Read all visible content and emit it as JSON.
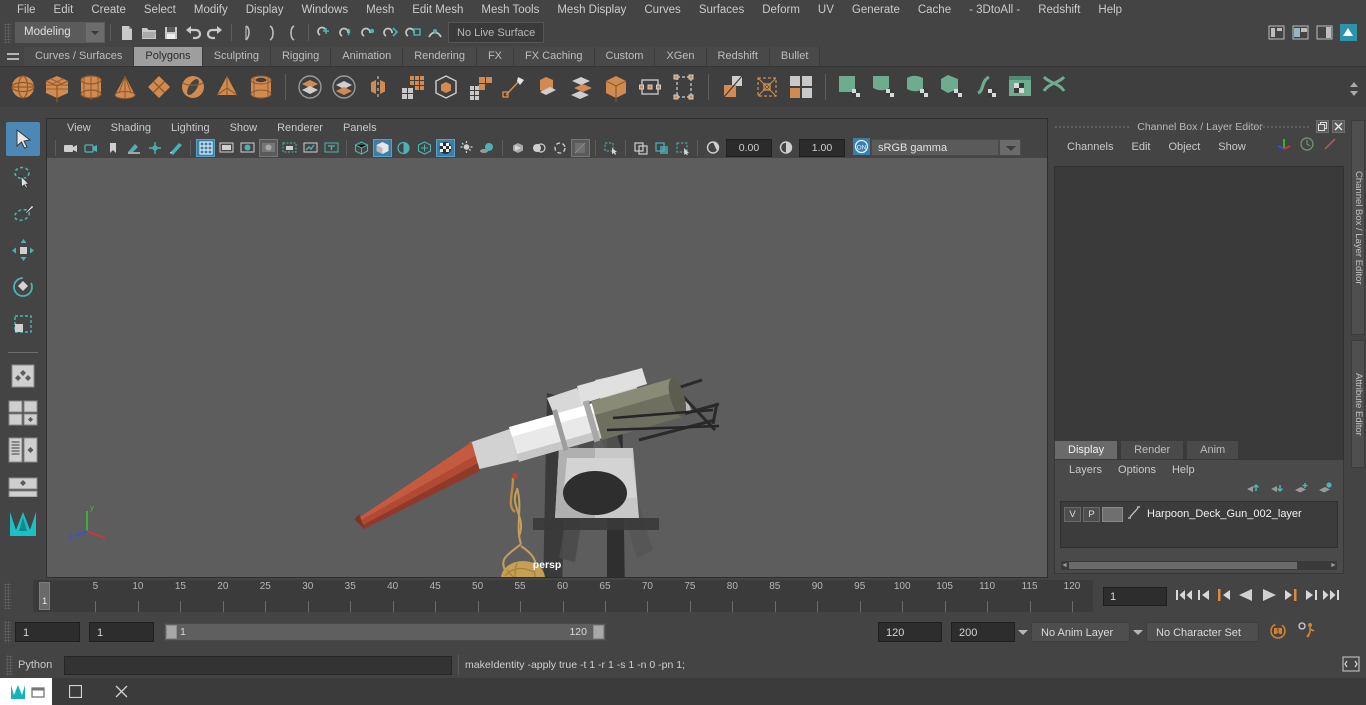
{
  "menubar": {
    "items": [
      "File",
      "Edit",
      "Create",
      "Select",
      "Modify",
      "Display",
      "Windows",
      "Mesh",
      "Edit Mesh",
      "Mesh Tools",
      "Mesh Display",
      "Curves",
      "Surfaces",
      "Deform",
      "UV",
      "Generate",
      "Cache",
      "- 3DtoAll -",
      "Redshift",
      "Help"
    ]
  },
  "statusline": {
    "mode": "Modeling",
    "live_surface": "No Live Surface",
    "icons": [
      "new-scene-icon",
      "open-scene-icon",
      "save-scene-icon",
      "undo-icon",
      "redo-icon",
      "select-hierarchy-icon",
      "select-object-icon",
      "select-component-icon",
      "snap-grid-icon",
      "snap-curve-icon",
      "snap-point-icon",
      "snap-projected-icon",
      "snap-view-plane-icon",
      "make-live-icon"
    ]
  },
  "shelf": {
    "tabs": [
      "Curves / Surfaces",
      "Polygons",
      "Sculpting",
      "Rigging",
      "Animation",
      "Rendering",
      "FX",
      "FX Caching",
      "Custom",
      "XGen",
      "Redshift",
      "Bullet"
    ],
    "active_tab": "Polygons",
    "buttons": [
      "poly-sphere-icon",
      "poly-cube-icon",
      "poly-cylinder-icon",
      "poly-cone-icon",
      "poly-plane-icon",
      "poly-torus-icon",
      "poly-pyramid-icon",
      "poly-pipe-icon",
      "combine-icon",
      "separate-icon",
      "mirror-icon",
      "smooth-icon",
      "boolean-icon",
      "subdiv-proxy-icon",
      "multi-cut-icon",
      "extrude-icon",
      "bevel-icon",
      "bridge-icon",
      "append-polygon-icon",
      "target-weld-icon",
      "quad-draw-icon",
      "crease-tool-icon",
      "poly-uv-icon",
      "uv-editor-icon",
      "auto-uv-icon",
      "planar-map-icon",
      "cylindrical-map-icon",
      "spherical-map-icon",
      "unfold-uv-icon",
      "uv-layout-icon",
      "uv-snapshot-icon"
    ]
  },
  "toolbox": {
    "items": [
      "select-tool-icon",
      "lasso-select-tool-icon",
      "paint-select-tool-icon",
      "move-tool-icon",
      "rotate-tool-icon",
      "scale-tool-icon",
      "last-tool-icon",
      "single-pane-layout-icon",
      "four-pane-layout-icon",
      "persp-outliner-layout-icon",
      "persp-graph-layout-icon",
      "maya-logo-icon"
    ],
    "active": "select-tool-icon"
  },
  "viewport": {
    "menus": [
      "View",
      "Shading",
      "Lighting",
      "Show",
      "Renderer",
      "Panels"
    ],
    "toolbar_icons": [
      "select-camera-icon",
      "camera-attributes-icon",
      "bookmark-icon",
      "image-plane-icon",
      "two-d-pan-zoom-icon",
      "grease-pencil-icon",
      "grid-toggle-icon",
      "film-gate-icon",
      "resolution-gate-icon",
      "gate-mask-icon",
      "film-origin-icon",
      "exposure-icon",
      "title-safe-icon",
      "wireframe-icon",
      "smooth-shade-icon",
      "shaded-wireframe-icon",
      "textured-icon",
      "checker-texture-icon",
      "use-lights-icon",
      "shadows-icon",
      "ambient-occlusion-icon",
      "motion-blur-icon",
      "multisample-icon",
      "depth-of-field-icon",
      "isolate-select-icon",
      "xray-icon",
      "xray-joints-icon",
      "xray-active-components-icon",
      "exposure-wheel-icon",
      "gamma-icon"
    ],
    "exposure": "0.00",
    "gamma": "1.00",
    "color_management": "sRGB gamma",
    "color_management_toggle": "ON",
    "camera_label": "persp",
    "axis_labels": {
      "x": "x",
      "y": "y",
      "z": "z"
    }
  },
  "channel_box": {
    "title": "Channel Box / Layer Editor",
    "menus": [
      "Channels",
      "Edit",
      "Object",
      "Show"
    ],
    "header_icons": [
      "axis-icon",
      "clock-icon",
      "pencil-icon"
    ],
    "window_buttons": [
      "restore-icon",
      "close-icon"
    ]
  },
  "layer_editor": {
    "tabs": [
      "Display",
      "Render",
      "Anim"
    ],
    "active_tab": "Display",
    "menus": [
      "Layers",
      "Options",
      "Help"
    ],
    "toolbar_icons": [
      "move-layer-up-icon",
      "move-layer-down-icon",
      "new-layer-icon",
      "new-layer-from-selected-icon"
    ],
    "layers": [
      {
        "visibility": "V",
        "playback": "P",
        "color_swatch": "",
        "name": "Harpoon_Deck_Gun_002_layer"
      }
    ]
  },
  "right_tabs": [
    "Channel Box / Layer Editor",
    "Attribute Editor"
  ],
  "time_slider": {
    "ticks": [
      5,
      10,
      15,
      20,
      25,
      30,
      35,
      40,
      45,
      50,
      55,
      60,
      65,
      70,
      75,
      80,
      85,
      90,
      95,
      100,
      105,
      110,
      115,
      120
    ],
    "current_frame": "1",
    "frame_field": "1",
    "playback_buttons": [
      "go-to-start-icon",
      "step-back-frame-icon",
      "step-back-key-icon",
      "play-backwards-icon",
      "play-forwards-icon",
      "step-forward-key-icon",
      "step-forward-frame-icon",
      "go-to-end-icon"
    ]
  },
  "range_slider": {
    "start_field": "1",
    "playback_start_field": "1",
    "range_start_label": "1",
    "range_end_label": "120",
    "playback_end_field": "120",
    "end_field": "200",
    "anim_layer": "No Anim Layer",
    "character_set": "No Character Set",
    "right_icons": [
      "auto-keyframe-icon",
      "animation-preferences-icon"
    ]
  },
  "command_line": {
    "language": "Python",
    "input_value": "",
    "output": "makeIdentity -apply true -t 1 -r 1 -s 1 -n 0 -pn 1;",
    "script-editor-icon": "script-editor-icon"
  },
  "taskbar": {
    "buttons": [
      "app-icon",
      "window-icon",
      "close-icon"
    ]
  },
  "colors": {
    "accent_blue": "#4c88b5",
    "shelf_orange": "#d18b50",
    "shelf_green": "#6fab8e",
    "teal": "#4cb3b3",
    "panel_bg": "#444444",
    "viewport_bg": "#5d5d5d"
  }
}
